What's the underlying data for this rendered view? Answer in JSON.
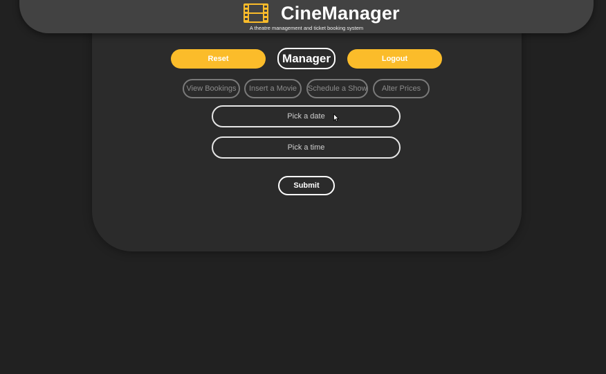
{
  "header": {
    "title": "CineManager",
    "subtitle": "A theatre management and ticket booking system",
    "logo_icon": "film-strip-icon",
    "logo_color": "#fbbc2a"
  },
  "actions": {
    "reset_label": "Reset",
    "role_label": "Manager",
    "logout_label": "Logout"
  },
  "tabs": [
    {
      "label": "View Bookings"
    },
    {
      "label": "Insert a Movie"
    },
    {
      "label": "Schedule a Show"
    },
    {
      "label": "Alter Prices"
    }
  ],
  "form": {
    "date_placeholder": "Pick a date",
    "time_placeholder": "Pick a time",
    "submit_label": "Submit"
  },
  "colors": {
    "accent": "#fbbc2a",
    "background": "#212121",
    "panel": "#2b2b2b",
    "header": "#424242"
  }
}
